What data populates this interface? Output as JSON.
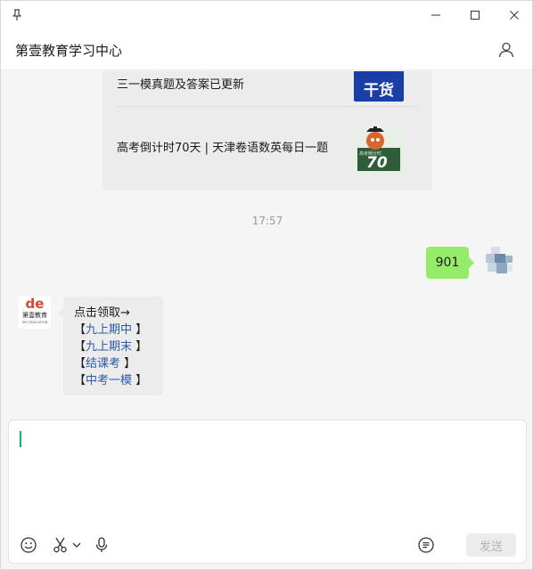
{
  "window": {
    "title": "第壹教育学习中心"
  },
  "chat": {
    "articles": [
      {
        "title": "三一模真题及答案已更新",
        "thumb_text": "干货"
      },
      {
        "title": "高考倒计时70天 | 天津卷语数英每日一题",
        "thumb_text": "70",
        "thumb_small": "高考倒计时"
      }
    ],
    "time": "17:57",
    "sent_message": "901",
    "reply": {
      "avatar_logo": "de",
      "avatar_name": "第壹教育",
      "avatar_sub": "DIYI EDUCATION",
      "intro": "点击领取→",
      "links": [
        "九上期中",
        "九上期末",
        "结课考",
        "中考一模"
      ]
    }
  },
  "composer": {
    "send_label": "发送"
  },
  "colors": {
    "accent_green": "#07c160",
    "sent_bubble": "#95ec69",
    "link_blue": "#2b5aa9",
    "brand_red": "#e0452c"
  },
  "icons": [
    "pin-icon",
    "minimize-icon",
    "maximize-icon",
    "close-icon",
    "user-icon",
    "emoji-icon",
    "scissors-icon",
    "chevron-down-icon",
    "microphone-icon",
    "chat-history-icon"
  ]
}
